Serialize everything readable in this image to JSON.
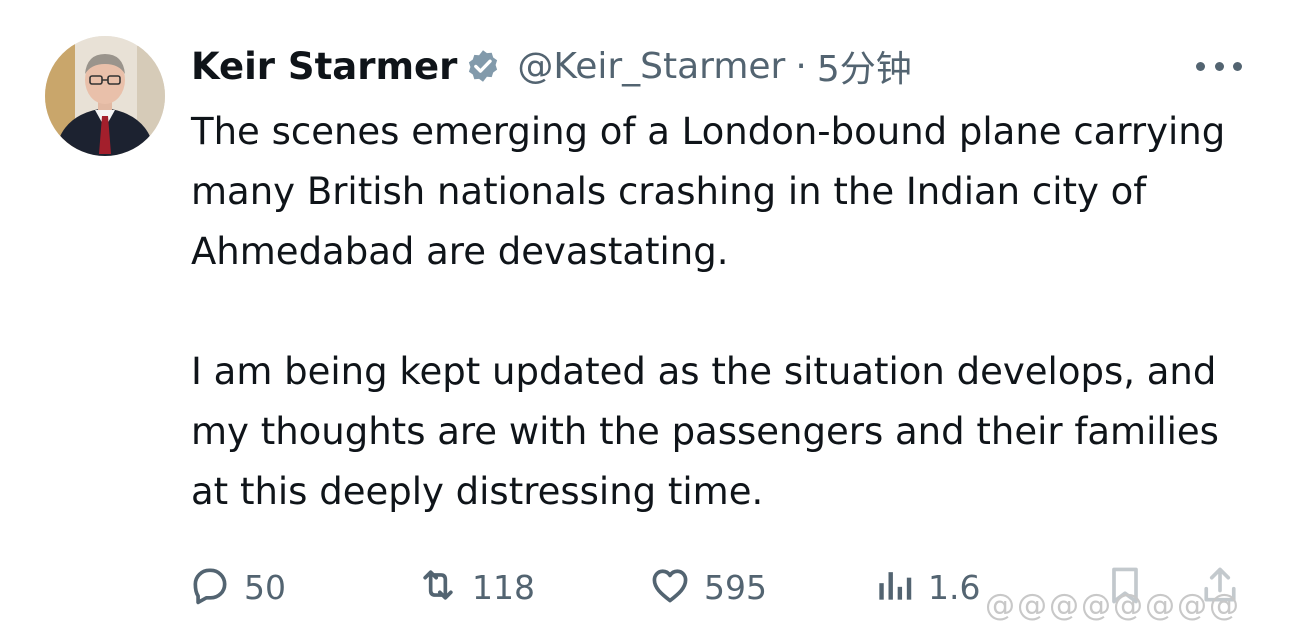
{
  "tweet": {
    "author_name": "Keir Starmer",
    "handle": "@Keir_Starmer",
    "separator": "·",
    "time": "5分钟",
    "paragraphs": [
      "The scenes emerging of a London-bound plane carrying many British nationals crashing in the Indian city of Ahmedabad are devastating.",
      "I am being kept updated as the situation develops, and my thoughts are with the passengers and their families at this deeply distressing time."
    ]
  },
  "actions": {
    "replies": "50",
    "retweets": "118",
    "likes": "595",
    "views": "1.6"
  },
  "watermark": "@@@@@@@@",
  "colors": {
    "text": "#0f1419",
    "secondary": "#536471",
    "verified": "#829aab"
  },
  "icons": [
    "verified-badge-icon",
    "more-icon",
    "reply-icon",
    "retweet-icon",
    "like-icon",
    "views-icon",
    "bookmark-icon",
    "share-icon"
  ]
}
